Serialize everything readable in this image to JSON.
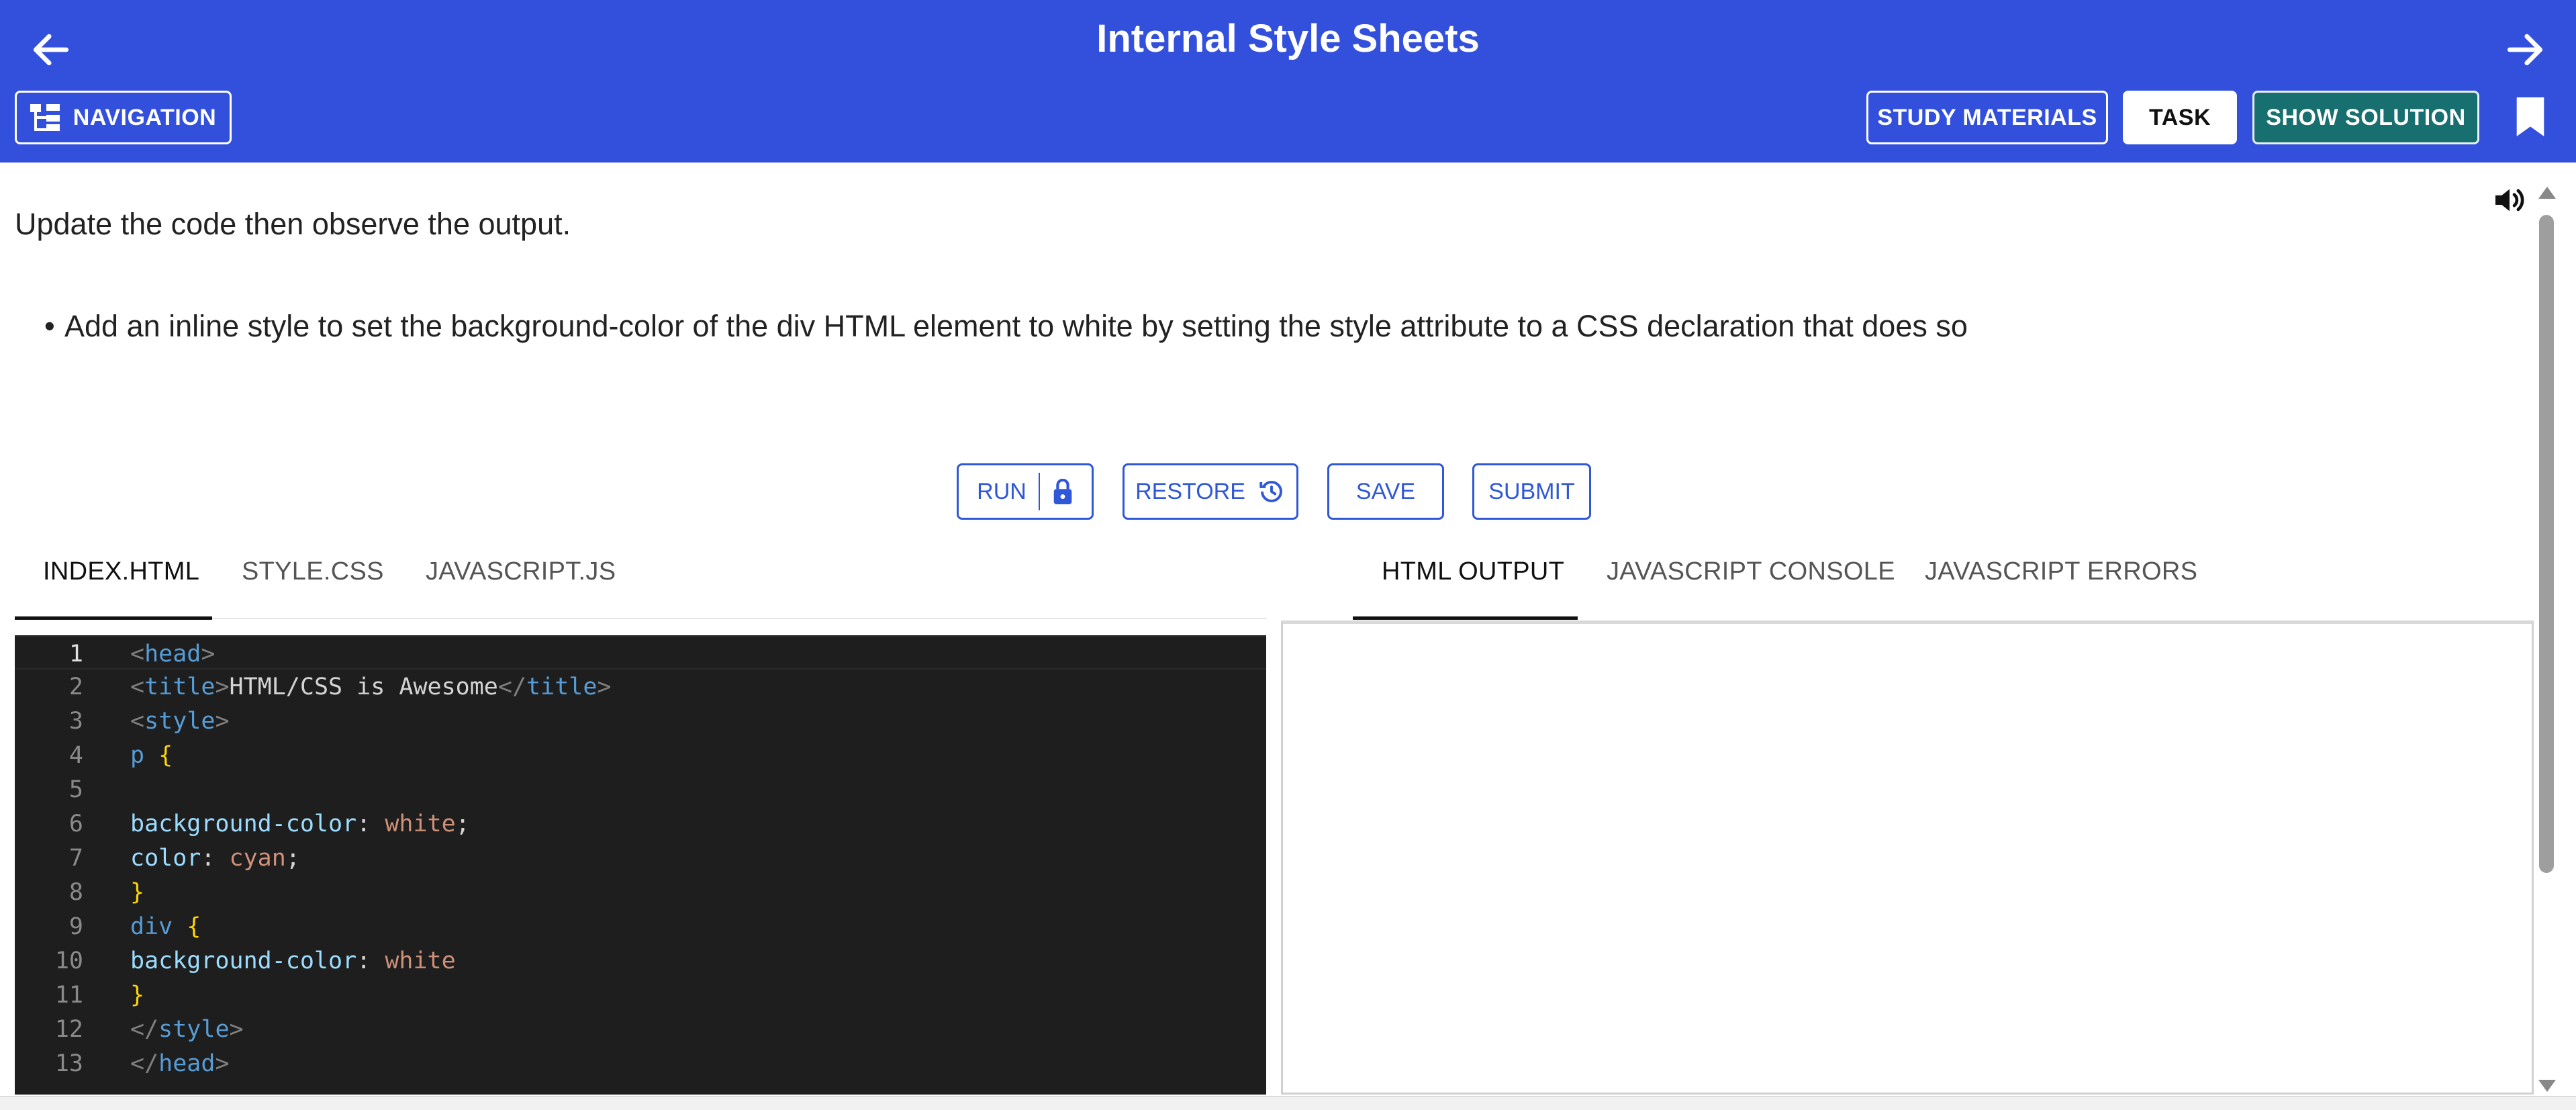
{
  "header": {
    "title": "Internal Style Sheets",
    "back_icon": "arrow-left-icon",
    "forward_icon": "arrow-right-icon",
    "navigation_label": "NAVIGATION",
    "study_materials_label": "STUDY MATERIALS",
    "task_label": "TASK",
    "show_solution_label": "SHOW SOLUTION",
    "bookmark_icon": "bookmark-icon",
    "background_color": "#3350dc",
    "solution_color": "#176f6f"
  },
  "task": {
    "intro": "Update the code then observe the output.",
    "bullets": [
      "Add an inline style to set the background-color of the div HTML element to white by setting the style attribute to a CSS declaration that does so"
    ]
  },
  "actions": {
    "run_label": "RUN",
    "restore_label": "RESTORE",
    "save_label": "SAVE",
    "submit_label": "SUBMIT",
    "accent_color": "#2f57d8"
  },
  "editor_tabs": [
    {
      "label": "INDEX.HTML",
      "active": true
    },
    {
      "label": "STYLE.CSS",
      "active": false
    },
    {
      "label": "JAVASCRIPT.JS",
      "active": false
    }
  ],
  "output_tabs": [
    {
      "label": "HTML OUTPUT",
      "active": true
    },
    {
      "label": "JAVASCRIPT CONSOLE",
      "active": false
    },
    {
      "label": "JAVASCRIPT ERRORS",
      "active": false
    }
  ],
  "code_lines": [
    {
      "n": "1",
      "text": "<head>"
    },
    {
      "n": "2",
      "text": "<title>HTML/CSS is Awesome</title>"
    },
    {
      "n": "3",
      "text": "<style>"
    },
    {
      "n": "4",
      "text": "p {"
    },
    {
      "n": "5",
      "text": ""
    },
    {
      "n": "6",
      "text": "background-color: white;"
    },
    {
      "n": "7",
      "text": "color: cyan;"
    },
    {
      "n": "8",
      "text": "}"
    },
    {
      "n": "9",
      "text": "div {"
    },
    {
      "n": "10",
      "text": "background-color: white"
    },
    {
      "n": "11",
      "text": "}"
    },
    {
      "n": "12",
      "text": "</style>"
    },
    {
      "n": "13",
      "text": "</head>"
    }
  ]
}
